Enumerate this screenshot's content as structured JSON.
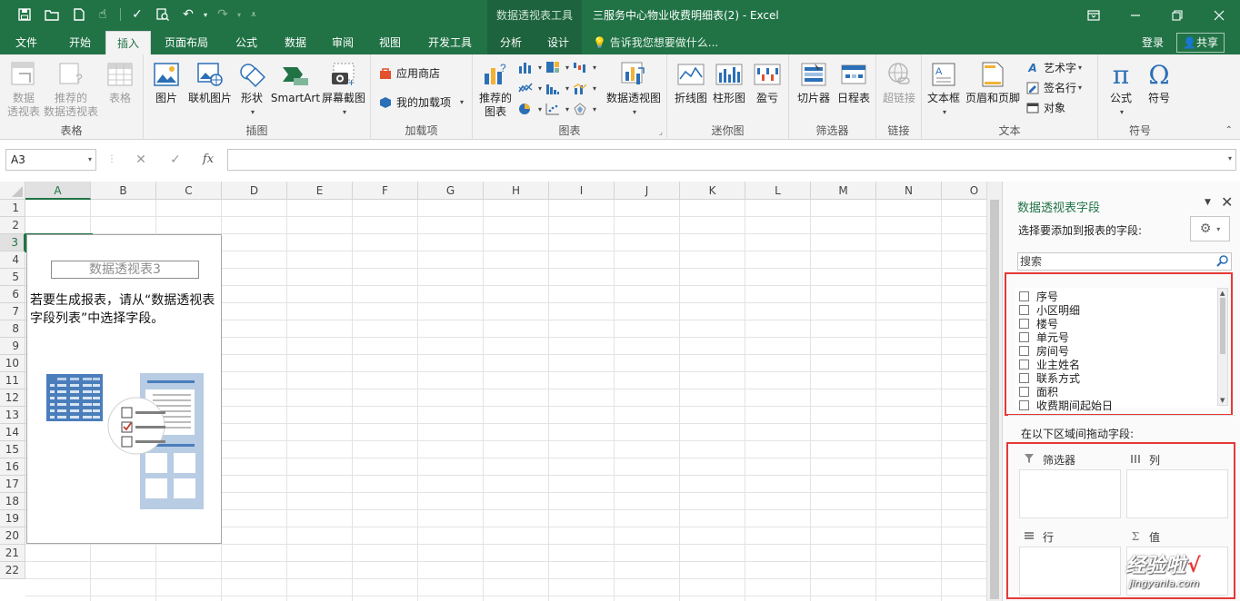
{
  "app": {
    "context_tools_label": "数据透视表工具",
    "doc_title": "三服务中心物业收费明细表(2) - Excel"
  },
  "tabs": [
    {
      "label": "文件"
    },
    {
      "label": "开始"
    },
    {
      "label": "插入"
    },
    {
      "label": "页面布局"
    },
    {
      "label": "公式"
    },
    {
      "label": "数据"
    },
    {
      "label": "审阅"
    },
    {
      "label": "视图"
    },
    {
      "label": "开发工具"
    },
    {
      "label": "分析"
    },
    {
      "label": "设计"
    }
  ],
  "tellme": "告诉我您想要做什么...",
  "account": {
    "login": "登录",
    "share": "共享"
  },
  "ribbon": {
    "groups": {
      "tables": "表格",
      "illustrations": "插图",
      "addins": "加载项",
      "charts": "图表",
      "sparklines": "迷你图",
      "filters": "筛选器",
      "links": "链接",
      "text": "文本",
      "symbols": "符号"
    },
    "buttons": {
      "pivot_l1": "数据",
      "pivot_l2": "透视表",
      "rec_pivot_l1": "推荐的",
      "rec_pivot_l2": "数据透视表",
      "table": "表格",
      "picture": "图片",
      "online_picture": "联机图片",
      "shapes": "形状",
      "smartart": "SmartArt",
      "screenshot": "屏幕截图",
      "store": "应用商店",
      "my_addins": "我的加载项",
      "rec_charts_l1": "推荐的",
      "rec_charts_l2": "图表",
      "pivot_chart": "数据透视图",
      "line": "折线图",
      "column": "柱形图",
      "winloss": "盈亏",
      "slicer": "切片器",
      "timeline": "日程表",
      "hyperlink": "超链接",
      "textbox": "文本框",
      "header_footer": "页眉和页脚",
      "wordart": "艺术字",
      "signature": "签名行",
      "object": "对象",
      "equation": "公式",
      "symbol": "符号"
    }
  },
  "formula_bar": {
    "name_box": "A3",
    "fx": "fx",
    "value": ""
  },
  "grid": {
    "columns": [
      "A",
      "B",
      "C",
      "D",
      "E",
      "F",
      "G",
      "H",
      "I",
      "J",
      "K",
      "L",
      "M",
      "N",
      "O"
    ],
    "rows": [
      "1",
      "2",
      "3",
      "4",
      "5",
      "6",
      "7",
      "8",
      "9",
      "10",
      "11",
      "12",
      "13",
      "14",
      "15",
      "16",
      "17",
      "18",
      "19",
      "20",
      "21",
      "22"
    ],
    "selected_col": "A",
    "selected_row": "3"
  },
  "pivot": {
    "name": "数据透视表3",
    "message": "若要生成报表，请从“数据透视表字段列表”中选择字段。"
  },
  "field_pane": {
    "title": "数据透视表字段",
    "choose_label": "选择要添加到报表的字段:",
    "search_placeholder": "搜索",
    "fields": [
      "序号",
      "小区明细",
      "楼号",
      "单元号",
      "房间号",
      "业主姓名",
      "联系方式",
      "面积",
      "收费期间起始日"
    ],
    "drag_label": "在以下区域间拖动字段:",
    "areas": {
      "filters": "筛选器",
      "columns": "列",
      "rows": "行",
      "values": "值"
    }
  },
  "watermark": {
    "text": "经验啦",
    "url": "jingyanla.com"
  },
  "colors": {
    "excel_green": "#217346",
    "highlight_red": "#e53935"
  }
}
